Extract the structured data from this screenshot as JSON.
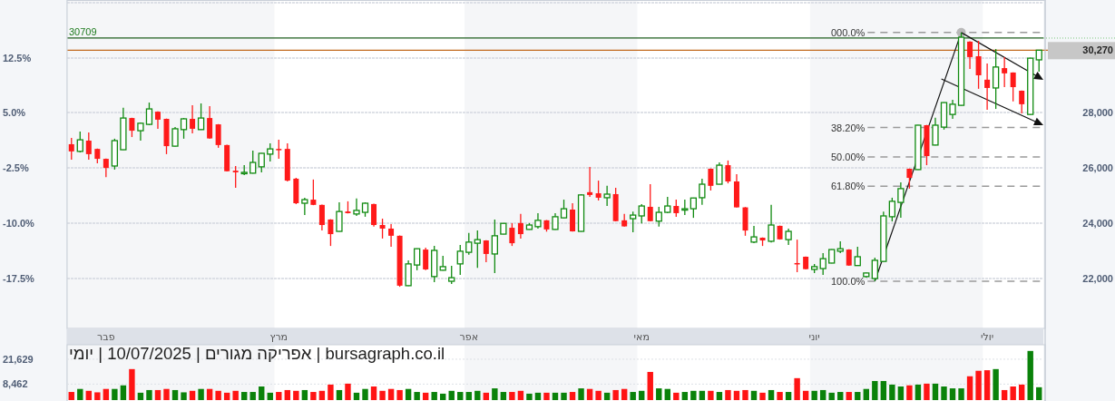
{
  "price_chart": {
    "chart_data": {
      "type": "candlestick",
      "ylim": [
        20180,
        32090
      ],
      "y2lim": [
        -24.33,
        20.34
      ],
      "grid": true,
      "ref_lines": [
        {
          "axis": "y",
          "value": 30709,
          "label": "30709",
          "color": "#1f5f1f"
        },
        {
          "axis": "y",
          "value": 30270,
          "label": "30,270",
          "color": "#c2691c"
        }
      ],
      "yticks": [
        {
          "value": 28000,
          "label": "28,000"
        },
        {
          "value": 26000,
          "label": "26,000"
        },
        {
          "value": 24000,
          "label": "24,000"
        },
        {
          "value": 22000,
          "label": "22,000"
        }
      ],
      "y2ticks": [
        {
          "value": 12.5,
          "label": "12.5%"
        },
        {
          "value": 5,
          "label": "5.0%"
        },
        {
          "value": -2.5,
          "label": "-2.5%"
        },
        {
          "value": -10,
          "label": "-10.0%"
        },
        {
          "value": -17.5,
          "label": "-17.5%"
        }
      ],
      "categories": [
        null,
        null,
        null,
        null,
        "פבר",
        null,
        null,
        null,
        null,
        null,
        null,
        null,
        null,
        null,
        null,
        null,
        null,
        null,
        null,
        null,
        null,
        null,
        null,
        null,
        "מרץ",
        null,
        null,
        null,
        null,
        null,
        null,
        null,
        null,
        null,
        null,
        null,
        null,
        null,
        null,
        null,
        null,
        null,
        null,
        null,
        null,
        null,
        "אפר",
        null,
        null,
        null,
        null,
        null,
        null,
        null,
        null,
        null,
        null,
        null,
        null,
        null,
        null,
        null,
        null,
        null,
        null,
        null,
        "מאי",
        null,
        null,
        null,
        null,
        null,
        null,
        null,
        null,
        null,
        null,
        null,
        null,
        null,
        null,
        null,
        null,
        null,
        null,
        null,
        "יוני",
        null,
        null,
        null,
        null,
        null,
        null,
        null,
        null,
        null,
        null,
        null,
        null,
        null,
        null,
        null,
        null,
        null,
        null,
        null,
        "יולי",
        null,
        null,
        null,
        null,
        null,
        null
      ],
      "ohlc": [
        [
          26860,
          27090,
          26300,
          26600
        ],
        [
          26600,
          27320,
          26560,
          27020
        ],
        [
          26990,
          27290,
          26300,
          26500
        ],
        [
          26690,
          26700,
          26170,
          26330
        ],
        [
          26330,
          26340,
          25670,
          26000
        ],
        [
          26070,
          27060,
          25940,
          26990
        ],
        [
          26660,
          28180,
          26650,
          27810
        ],
        [
          27810,
          27820,
          27120,
          27350
        ],
        [
          27350,
          27650,
          26990,
          27620
        ],
        [
          27580,
          28370,
          27550,
          28140
        ],
        [
          28040,
          28050,
          27420,
          27750
        ],
        [
          27780,
          27790,
          26500,
          26790
        ],
        [
          26790,
          27480,
          26780,
          27420
        ],
        [
          27390,
          27810,
          27060,
          27780
        ],
        [
          27780,
          28270,
          27250,
          27420
        ],
        [
          27390,
          28340,
          27380,
          27810
        ],
        [
          27810,
          28240,
          27060,
          27070
        ],
        [
          27580,
          27590,
          26730,
          26830
        ],
        [
          26830,
          26840,
          25870,
          25880
        ],
        [
          25900,
          26070,
          25280,
          25840
        ],
        [
          25810,
          26100,
          25740,
          25840
        ],
        [
          25810,
          26630,
          25800,
          26200
        ],
        [
          26040,
          26540,
          25840,
          26530
        ],
        [
          26500,
          26890,
          26230,
          26690
        ],
        [
          26690,
          27020,
          26330,
          26660
        ],
        [
          26690,
          26890,
          25510,
          25540
        ],
        [
          25610,
          25640,
          24690,
          24720
        ],
        [
          24720,
          24920,
          24290,
          24850
        ],
        [
          24850,
          25580,
          24650,
          24660
        ],
        [
          24660,
          24670,
          23730,
          23930
        ],
        [
          24130,
          24140,
          23170,
          23600
        ],
        [
          23700,
          24750,
          23690,
          24420
        ],
        [
          24420,
          24790,
          24350,
          24360
        ],
        [
          24330,
          24890,
          24260,
          24460
        ],
        [
          24390,
          24750,
          24230,
          24720
        ],
        [
          24690,
          24700,
          23870,
          23930
        ],
        [
          23930,
          24160,
          23440,
          23800
        ],
        [
          23800,
          23960,
          23140,
          23540
        ],
        [
          23540,
          23550,
          21690,
          21730
        ],
        [
          21730,
          22650,
          21720,
          22520
        ],
        [
          22480,
          23080,
          22290,
          23070
        ],
        [
          23040,
          23110,
          22290,
          22320
        ],
        [
          22060,
          23170,
          21860,
          23010
        ],
        [
          22290,
          22810,
          22280,
          22420
        ],
        [
          21890,
          22450,
          21790,
          22020
        ],
        [
          22520,
          23210,
          22120,
          22980
        ],
        [
          22940,
          23640,
          22850,
          23310
        ],
        [
          23270,
          23730,
          22380,
          23400
        ],
        [
          23370,
          23380,
          22580,
          22880
        ],
        [
          22880,
          24130,
          22190,
          23540
        ],
        [
          23600,
          24000,
          23590,
          23990
        ],
        [
          23830,
          24000,
          23170,
          23270
        ],
        [
          24000,
          24330,
          23440,
          23600
        ],
        [
          23770,
          24000,
          23760,
          23930
        ],
        [
          23870,
          24360,
          23800,
          24100
        ],
        [
          24100,
          24110,
          23690,
          23770
        ],
        [
          23770,
          24360,
          23760,
          24230
        ],
        [
          24190,
          24850,
          24180,
          24520
        ],
        [
          24490,
          24720,
          23690,
          23700
        ],
        [
          23700,
          25050,
          23690,
          25020
        ],
        [
          25120,
          26040,
          24950,
          25020
        ],
        [
          25080,
          25540,
          24820,
          24920
        ],
        [
          24920,
          25350,
          24620,
          25050
        ],
        [
          25050,
          25280,
          24060,
          24070
        ],
        [
          24100,
          24330,
          23870,
          23880
        ],
        [
          24160,
          24420,
          23670,
          24290
        ],
        [
          24260,
          24690,
          23990,
          24620
        ],
        [
          24590,
          25410,
          24060,
          24070
        ],
        [
          24070,
          24590,
          23870,
          24390
        ],
        [
          24390,
          24950,
          24360,
          24620
        ],
        [
          24620,
          24850,
          24230,
          24360
        ],
        [
          24490,
          24850,
          24290,
          24520
        ],
        [
          24520,
          24920,
          24190,
          24910
        ],
        [
          24920,
          25610,
          24660,
          25410
        ],
        [
          25970,
          25980,
          25180,
          25350
        ],
        [
          25410,
          26200,
          25400,
          26100
        ],
        [
          26100,
          26270,
          25440,
          25510
        ],
        [
          25510,
          25770,
          24560,
          24570
        ],
        [
          24570,
          24580,
          23540,
          23730
        ],
        [
          23310,
          23900,
          23270,
          23500
        ],
        [
          23470,
          23480,
          23170,
          23370
        ],
        [
          23340,
          24660,
          23300,
          23930
        ],
        [
          23900,
          23910,
          23400,
          23410
        ],
        [
          23400,
          23800,
          23210,
          23700
        ],
        [
          22550,
          23400,
          22220,
          22520
        ],
        [
          22780,
          22790,
          22320,
          22330
        ],
        [
          22320,
          22520,
          22190,
          22420
        ],
        [
          22350,
          22910,
          22120,
          22710
        ],
        [
          22550,
          23050,
          22540,
          23040
        ],
        [
          22980,
          23340,
          22910,
          23070
        ],
        [
          23040,
          23050,
          22450,
          22460
        ],
        [
          22460,
          23140,
          22450,
          22780
        ],
        [
          22060,
          22200,
          22020,
          22190
        ],
        [
          21990,
          22750,
          21890,
          22650
        ],
        [
          22610,
          24420,
          22600,
          24260
        ],
        [
          24230,
          24920,
          24060,
          24790
        ],
        [
          24750,
          25480,
          24190,
          25250
        ],
        [
          25970,
          25980,
          25250,
          25640
        ],
        [
          25940,
          27560,
          25930,
          27550
        ],
        [
          27550,
          27560,
          26100,
          26430
        ],
        [
          26830,
          27820,
          26820,
          27550
        ],
        [
          27480,
          28380,
          27390,
          28370
        ],
        [
          27940,
          28470,
          27780,
          28310
        ],
        [
          28270,
          30910,
          28260,
          30740
        ],
        [
          30580,
          30590,
          29590,
          30020
        ],
        [
          30050,
          30610,
          28870,
          29360
        ],
        [
          29200,
          29790,
          28110,
          28900
        ],
        [
          28900,
          30310,
          28140,
          29660
        ],
        [
          29620,
          30020,
          28930,
          29430
        ],
        [
          29460,
          29470,
          28410,
          28930
        ],
        [
          28800,
          28810,
          27980,
          28310
        ],
        [
          27940,
          29990,
          27930,
          29980
        ],
        [
          29920,
          30280,
          29490,
          30270
        ]
      ]
    },
    "overlays": [
      {
        "kind": "fibonacci",
        "levels": [
          {
            "text": "000.0%"
          },
          {
            "text": "38.20%"
          },
          {
            "text": "50.00%"
          },
          {
            "text": "61.80%"
          },
          {
            "text": "100.0%"
          }
        ]
      },
      {
        "kind": "trend_line"
      },
      {
        "kind": "pivot"
      },
      {
        "kind": "arrow"
      },
      {
        "kind": "arrow"
      }
    ]
  },
  "volume_chart": {
    "caption": "bursagraph.co.il | אפריקה מגורים | 10/07/2025 | יומי",
    "chart_data": {
      "type": "bar",
      "ylim": [
        0,
        29280
      ],
      "yticks": [
        {
          "value": 21629,
          "label": "21,629"
        },
        {
          "value": 8462,
          "label": "8,462"
        }
      ],
      "categories": [
        null,
        null,
        null,
        null,
        null,
        null,
        null,
        null,
        null,
        null,
        null,
        null,
        null,
        null,
        null,
        null,
        null,
        null,
        null,
        null,
        null,
        null,
        null,
        null,
        null,
        null,
        null,
        null,
        null,
        null,
        null,
        null,
        null,
        null,
        null,
        null,
        null,
        null,
        null,
        null,
        null,
        null,
        null,
        null,
        null,
        null,
        null,
        null,
        null,
        null,
        null,
        null,
        null,
        null,
        null,
        null,
        null,
        null,
        null,
        null,
        null,
        null,
        null,
        null,
        null,
        null,
        null,
        null,
        null,
        null,
        null,
        null,
        null,
        null,
        null,
        null,
        null,
        null,
        null,
        null,
        null,
        null,
        null,
        null,
        null,
        null,
        null,
        null,
        null,
        null,
        null,
        null,
        null,
        null,
        null,
        null,
        null,
        null,
        null,
        null,
        null,
        null,
        null,
        null,
        null,
        null,
        null,
        null,
        null,
        null,
        null,
        null,
        null
      ],
      "values": [
        4300,
        5900,
        4900,
        4100,
        5900,
        5900,
        7800,
        16400,
        3900,
        5300,
        5300,
        5900,
        5300,
        4100,
        4900,
        5900,
        5900,
        4900,
        3900,
        4900,
        4300,
        4300,
        7200,
        3900,
        4300,
        5300,
        4900,
        5300,
        4300,
        4900,
        8200,
        5300,
        8700,
        3900,
        5900,
        7200,
        4900,
        5900,
        5300,
        5900,
        4300,
        3900,
        4300,
        3400,
        4900,
        4300,
        4300,
        4900,
        3900,
        6200,
        4300,
        4300,
        4900,
        3400,
        3900,
        3900,
        3900,
        3900,
        4300,
        6200,
        5900,
        4900,
        3900,
        5300,
        5900,
        4300,
        4900,
        14900,
        6200,
        5900,
        3900,
        4300,
        4900,
        4900,
        4900,
        4300,
        5300,
        4900,
        5300,
        4900,
        3900,
        5300,
        4300,
        4300,
        11600,
        4900,
        4900,
        5300,
        3900,
        4300,
        4300,
        4300,
        5900,
        10100,
        10100,
        8200,
        7200,
        7800,
        8200,
        8700,
        8700,
        7200,
        6200,
        6200,
        12600,
        15500,
        15800,
        16400,
        5300,
        7200,
        8200,
        26000,
        6800
      ]
    }
  }
}
